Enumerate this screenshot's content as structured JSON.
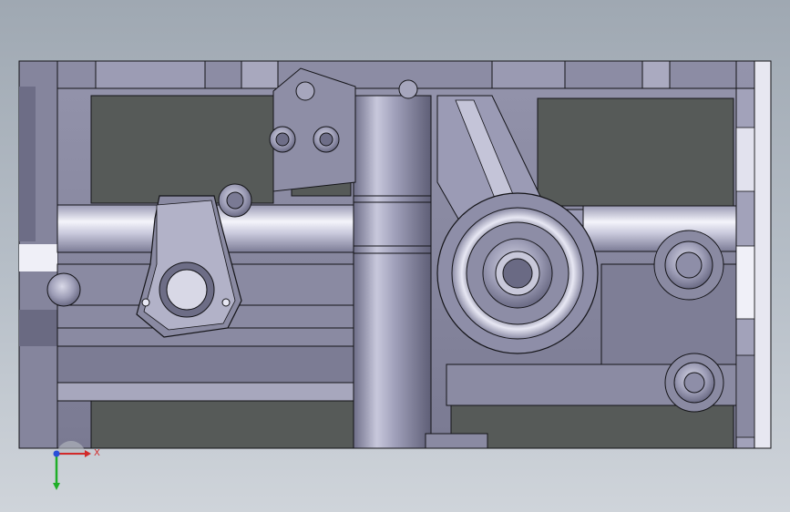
{
  "viewport": {
    "background_top": "#9fa8b2",
    "background_bottom": "#cfd4da"
  },
  "model": {
    "part_color": "#8e8ea6",
    "cavity_color": "#565a58",
    "edge_color": "#141418",
    "highlight_color": "#f2f2fa"
  },
  "triad": {
    "x_label": "X",
    "x_color": "#d22a2a",
    "y_color": "#1fae28",
    "z_color": "#2a4fd8"
  }
}
